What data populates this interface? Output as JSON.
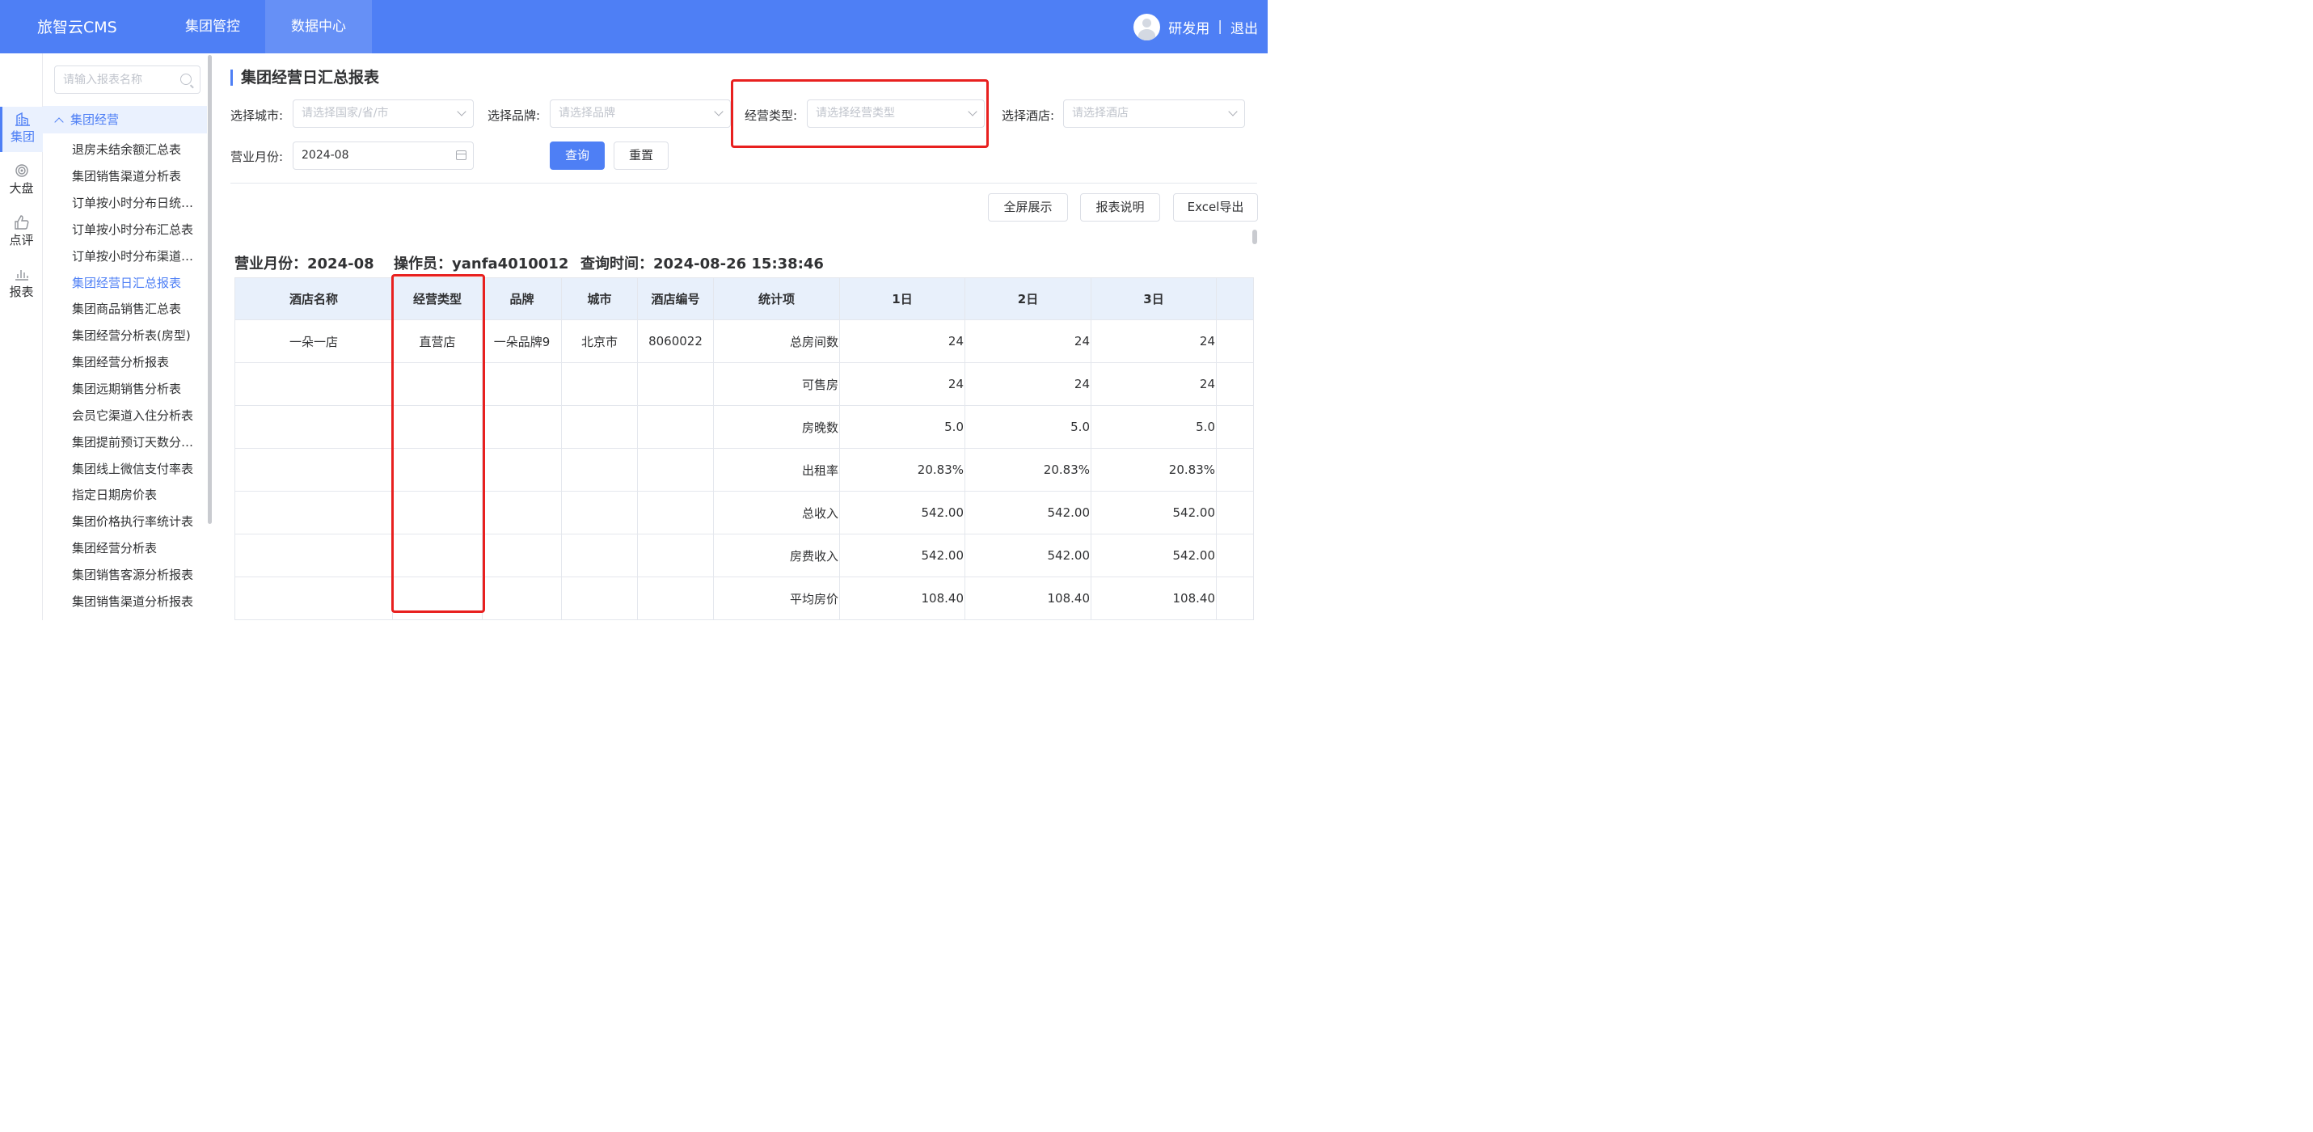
{
  "app": {
    "title": "旅智云CMS"
  },
  "nav": {
    "items": [
      {
        "label": "集团管控"
      },
      {
        "label": "数据中心"
      }
    ]
  },
  "user": {
    "name": "研发用",
    "sep": "|",
    "logout": "退出"
  },
  "iconbar": [
    {
      "label": "集团",
      "icon": "building-icon"
    },
    {
      "label": "大盘",
      "icon": "target-icon"
    },
    {
      "label": "点评",
      "icon": "thumbs-up-icon"
    },
    {
      "label": "报表",
      "icon": "bar-chart-icon"
    }
  ],
  "menu": {
    "search_placeholder": "请输入报表名称",
    "group": "集团经营",
    "items": [
      "退房未结余额汇总表",
      "集团销售渠道分析表",
      "订单按小时分布日统…",
      "订单按小时分布汇总表",
      "订单按小时分布渠道…",
      "集团经营日汇总报表",
      "集团商品销售汇总表",
      "集团经营分析表(房型)",
      "集团经营分析报表",
      "集团远期销售分析表",
      "会员它渠道入住分析表",
      "集团提前预订天数分…",
      "集团线上微信支付率表",
      "指定日期房价表",
      "集团价格执行率统计表",
      "集团经营分析表",
      "集团销售客源分析报表",
      "集团销售渠道分析报表"
    ]
  },
  "page": {
    "title": "集团经营日汇总报表"
  },
  "filters": {
    "city_label": "选择城市:",
    "city_placeholder": "请选择国家/省/市",
    "brand_label": "选择品牌:",
    "brand_placeholder": "请选择品牌",
    "type_label": "经营类型:",
    "type_placeholder": "请选择经营类型",
    "hotel_label": "选择酒店:",
    "hotel_placeholder": "请选择酒店",
    "month_label": "营业月份:",
    "month_value": "2024-08"
  },
  "buttons": {
    "query": "查询",
    "reset": "重置",
    "fullscreen": "全屏展示",
    "explain": "报表说明",
    "export": "Excel导出"
  },
  "meta": {
    "month_label": "营业月份：2024-08",
    "operator_label": "操作员：yanfa4010012",
    "time_label": "查询时间：2024-08-26 15:38:46"
  },
  "table": {
    "headers": [
      "酒店名称",
      "经营类型",
      "品牌",
      "城市",
      "酒店编号",
      "统计项",
      "1日",
      "2日",
      "3日",
      ""
    ],
    "rows": [
      [
        "一朵一店",
        "直营店",
        "一朵品牌9",
        "北京市",
        "8060022",
        "总房间数",
        "24",
        "24",
        "24",
        ""
      ],
      [
        "",
        "",
        "",
        "",
        "",
        "可售房",
        "24",
        "24",
        "24",
        ""
      ],
      [
        "",
        "",
        "",
        "",
        "",
        "房晚数",
        "5.0",
        "5.0",
        "5.0",
        ""
      ],
      [
        "",
        "",
        "",
        "",
        "",
        "出租率",
        "20.83%",
        "20.83%",
        "20.83%",
        ""
      ],
      [
        "",
        "",
        "",
        "",
        "",
        "总收入",
        "542.00",
        "542.00",
        "542.00",
        ""
      ],
      [
        "",
        "",
        "",
        "",
        "",
        "房费收入",
        "542.00",
        "542.00",
        "542.00",
        ""
      ],
      [
        "",
        "",
        "",
        "",
        "",
        "平均房价",
        "108.40",
        "108.40",
        "108.40",
        ""
      ]
    ]
  },
  "colors": {
    "brand": "#4e7ff5",
    "highlight": "#e8201f"
  }
}
